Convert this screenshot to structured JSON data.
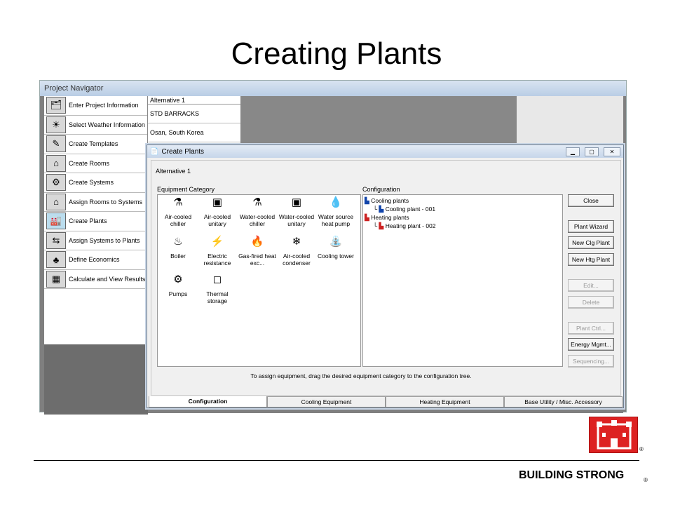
{
  "slide": {
    "title": "Creating Plants",
    "footer": "BUILDING STRONG",
    "registered": "®"
  },
  "navigator": {
    "title": "Project Navigator",
    "items": [
      {
        "label": "Enter Project Information",
        "icon": "folder-icon"
      },
      {
        "label": "Select Weather Information",
        "icon": "weather-icon"
      },
      {
        "label": "Create Templates",
        "icon": "templates-icon"
      },
      {
        "label": "Create Rooms",
        "icon": "house-icon"
      },
      {
        "label": "Create Systems",
        "icon": "fan-icon"
      },
      {
        "label": "Assign Rooms to Systems",
        "icon": "house-icon"
      },
      {
        "label": "Create Plants",
        "icon": "factory-icon"
      },
      {
        "label": "Assign Systems to Plants",
        "icon": "assign-icon"
      },
      {
        "label": "Define Economics",
        "icon": "tree-icon"
      },
      {
        "label": "Calculate and View Results",
        "icon": "calculator-icon"
      }
    ],
    "alternative": {
      "header": "Alternative 1",
      "values": [
        "STD BARRACKS",
        "Osan, South Korea"
      ]
    }
  },
  "dialog": {
    "title": "Create Plants",
    "alternative": "Alternative 1",
    "equipment_label": "Equipment Category",
    "configuration_label": "Configuration",
    "equipment": [
      {
        "label": "Air-cooled chiller",
        "icon": "air-cooled-chiller-icon"
      },
      {
        "label": "Air-cooled unitary",
        "icon": "air-cooled-unitary-icon"
      },
      {
        "label": "Water-cooled chiller",
        "icon": "water-cooled-chiller-icon"
      },
      {
        "label": "Water-cooled unitary",
        "icon": "water-cooled-unitary-icon"
      },
      {
        "label": "Water source heat pump",
        "icon": "heat-pump-icon"
      },
      {
        "label": "Boiler",
        "icon": "boiler-icon"
      },
      {
        "label": "Electric resistance",
        "icon": "electric-icon"
      },
      {
        "label": "Gas-fired heat exc...",
        "icon": "gas-fired-icon"
      },
      {
        "label": "Air-cooled condenser",
        "icon": "condenser-icon"
      },
      {
        "label": "Cooling tower",
        "icon": "cooling-tower-icon"
      },
      {
        "label": "Pumps",
        "icon": "pump-icon"
      },
      {
        "label": "Thermal storage",
        "icon": "thermal-storage-icon"
      }
    ],
    "tree": {
      "cooling_group": "Cooling plants",
      "cooling_item": "Cooling plant - 001",
      "heating_group": "Heating plants",
      "heating_item": "Heating plant - 002"
    },
    "hint": "To assign equipment, drag the desired equipment category to the configuration tree.",
    "buttons": {
      "close": "Close",
      "plant_wizard": "Plant Wizard",
      "new_clg": "New Clg Plant",
      "new_htg": "New Htg Plant",
      "edit": "Edit...",
      "delete": "Delete",
      "plant_ctrl": "Plant Ctrl...",
      "energy": "Energy Mgmt...",
      "sequencing": "Sequencing..."
    },
    "tabs": [
      "Configuration",
      "Cooling Equipment",
      "Heating Equipment",
      "Base Utility / Misc. Accessory"
    ]
  }
}
